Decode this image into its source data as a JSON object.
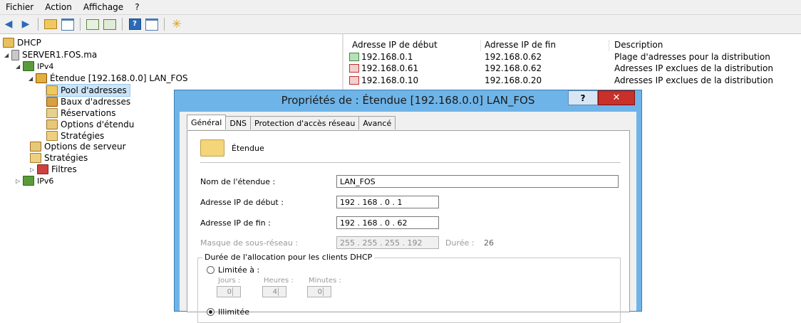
{
  "menu": [
    "Fichier",
    "Action",
    "Affichage",
    "?"
  ],
  "tree": {
    "root": "DHCP",
    "server": "SERVER1.FOS.ma",
    "ipv4": "IPv4",
    "scope": "Étendue [192.168.0.0] LAN_FOS",
    "pool": "Pool d'adresses",
    "leases": "Baux d'adresses",
    "reservations": "Réservations",
    "scope_options": "Options d'étendu",
    "scope_policies": "Stratégies",
    "server_options": "Options de serveur",
    "policies": "Stratégies",
    "filters": "Filtres",
    "ipv6": "IPv6"
  },
  "list": {
    "headers": [
      "Adresse IP de début",
      "Adresse IP de fin",
      "Description"
    ],
    "rows": [
      {
        "start": "192.168.0.1",
        "end": "192.168.0.62",
        "desc": "Plage d'adresses pour la distribution"
      },
      {
        "start": "192.168.0.61",
        "end": "192.168.0.62",
        "desc": "Adresses IP exclues de la distribution"
      },
      {
        "start": "192.168.0.10",
        "end": "192.168.0.20",
        "desc": "Adresses IP exclues de la distribution"
      }
    ]
  },
  "dialog": {
    "title": "Propriétés de : Étendue [192.168.0.0] LAN_FOS",
    "help": "?",
    "close": "✕",
    "tabs": [
      "Général",
      "DNS",
      "Protection d'accès réseau",
      "Avancé"
    ],
    "section_label": "Étendue",
    "name_label": "Nom de l'étendue :",
    "name_value": "LAN_FOS",
    "start_label": "Adresse IP de début :",
    "start_value": "192 . 168 .  0  .  1",
    "end_label": "Adresse IP de fin :",
    "end_value": "192 . 168 .  0  . 62",
    "mask_label": "Masque de sous-réseau :",
    "mask_value": "255 . 255 . 255 . 192",
    "length_label": "Durée :",
    "length_value": "26",
    "lease_group": "Durée de l'allocation pour les clients DHCP",
    "limited_label": "Limitée à :",
    "days_label": "Jours :",
    "days_value": "0",
    "hours_label": "Heures :",
    "hours_value": "4",
    "minutes_label": "Minutes :",
    "minutes_value": "0",
    "unlimited_label": "Illimitée"
  }
}
